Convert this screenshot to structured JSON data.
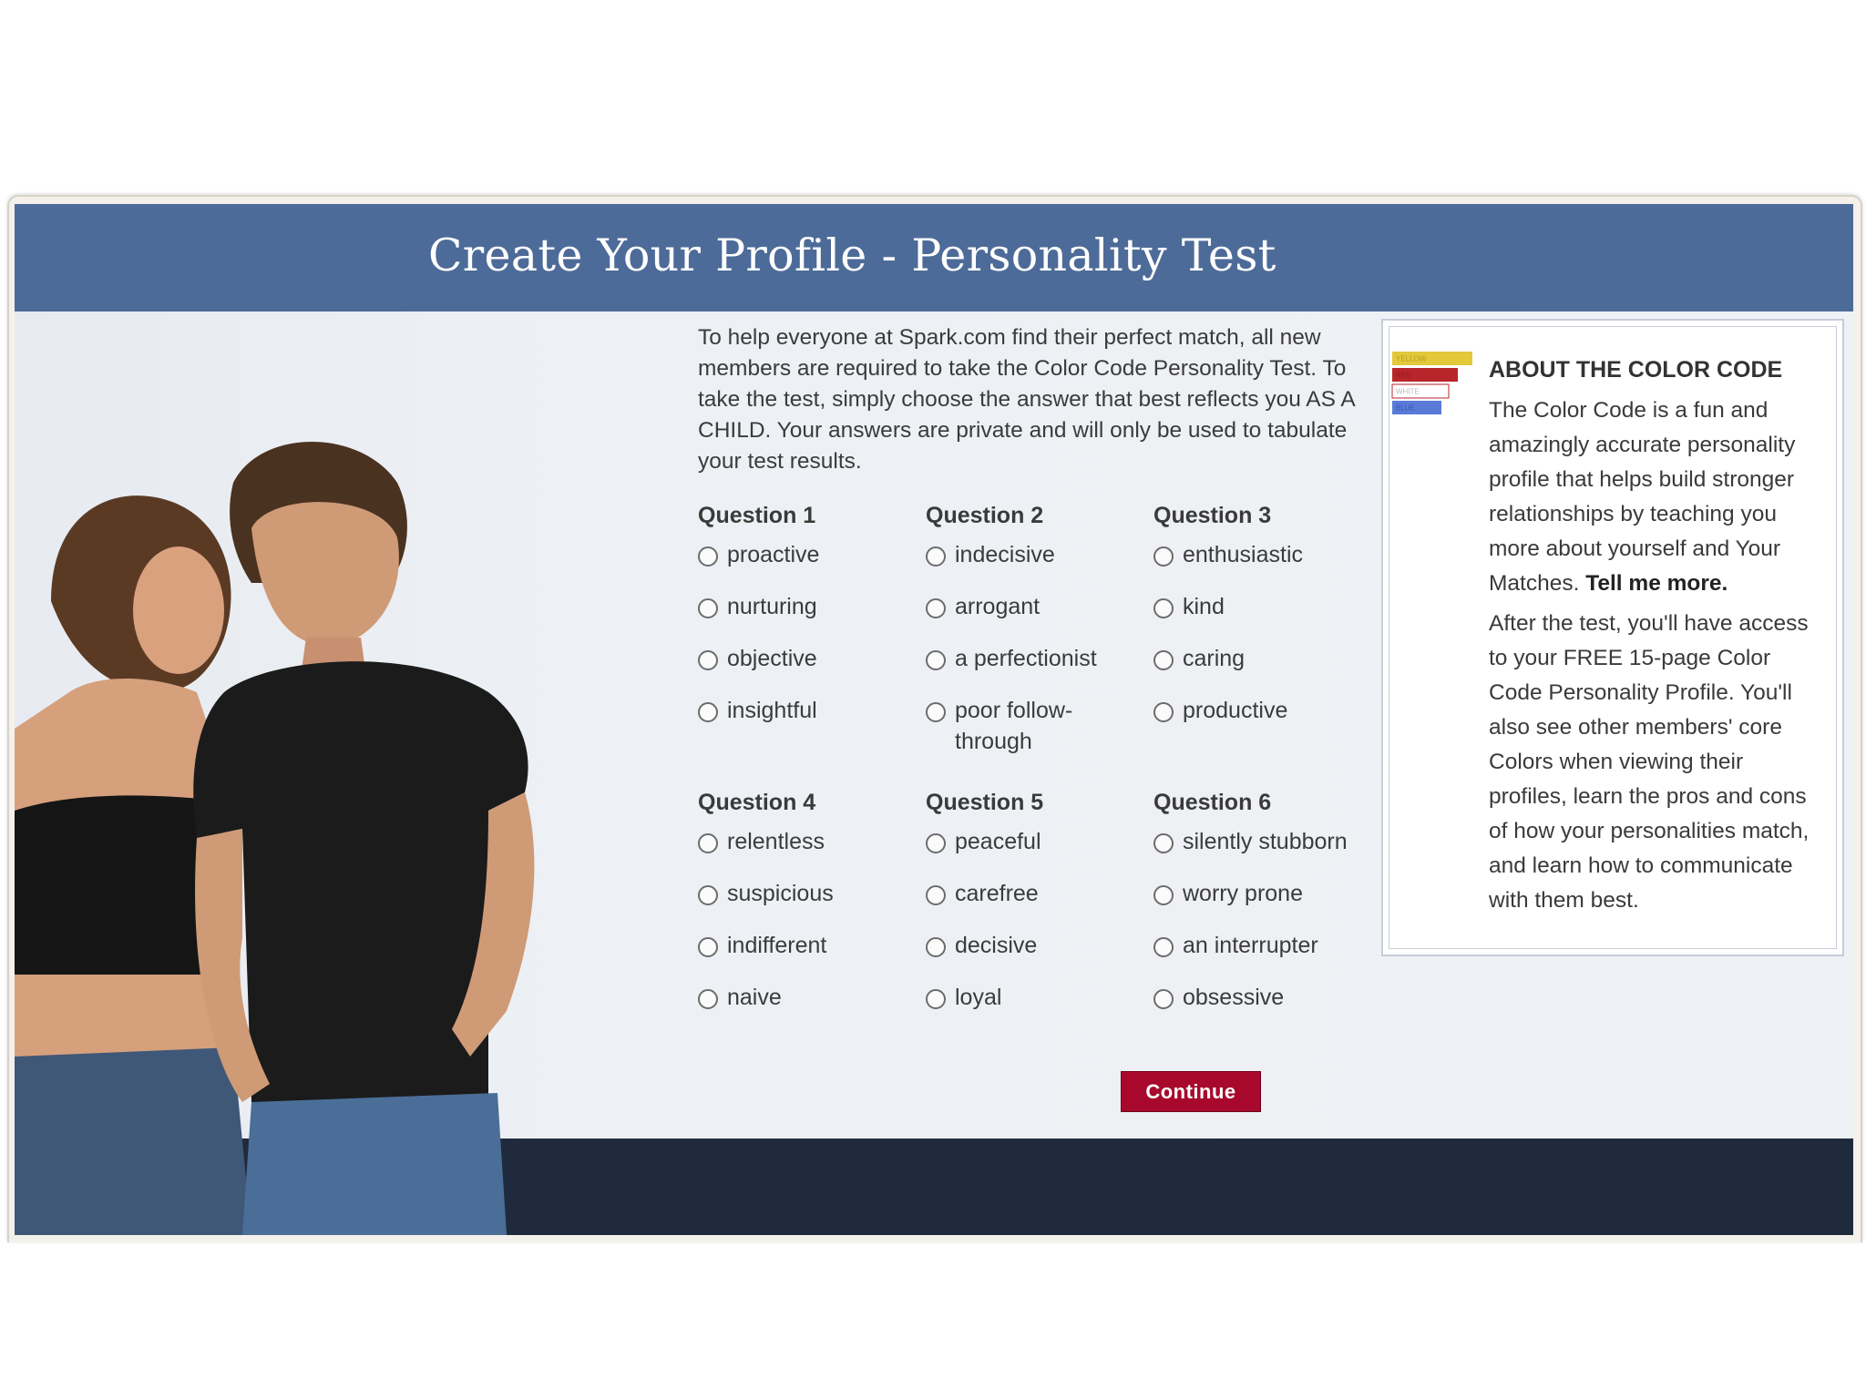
{
  "header": {
    "title": "Create Your Profile - Personality Test"
  },
  "intro": "To help everyone at Spark.com find their perfect match, all new members are required to take the Color Code Personality Test. To take the test, simply choose the answer that best reflects you AS A CHILD. Your answers are private and will only be used to tabulate your test results.",
  "questions": [
    {
      "label": "Question 1",
      "options": [
        "proactive",
        "nurturing",
        "objective",
        "insightful"
      ]
    },
    {
      "label": "Question 2",
      "options": [
        "indecisive",
        "arrogant",
        "a perfectionist",
        "poor follow-through"
      ]
    },
    {
      "label": "Question 3",
      "options": [
        "enthusiastic",
        "kind",
        "caring",
        "productive"
      ]
    },
    {
      "label": "Question 4",
      "options": [
        "relentless",
        "suspicious",
        "indifferent",
        "naive"
      ]
    },
    {
      "label": "Question 5",
      "options": [
        "peaceful",
        "carefree",
        "decisive",
        "loyal"
      ]
    },
    {
      "label": "Question 6",
      "options": [
        "silently stubborn",
        "worry prone",
        "an interrupter",
        "obsessive"
      ]
    }
  ],
  "continue_label": "Continue",
  "aside": {
    "title": "ABOUT THE COLOR CODE",
    "para1": "The Color Code is a fun and amazingly accurate personality profile that helps build stronger relationships by teaching you more about yourself and Your Matches.",
    "link": "Tell me more.",
    "para2": "After the test, you'll have access to your FREE 15-page Color Code Personality Profile. You'll also see other members' core Colors when viewing their profiles, learn the pros and cons of how your personalities match, and learn how to communicate with them best.",
    "logo_labels": [
      "YELLOW",
      "RED",
      "WHITE",
      "BLUE"
    ]
  },
  "colors": {
    "header": "#4d6b98",
    "button": "#a8082c",
    "footer": "#1f2b3d",
    "logo": [
      "#e3c83a",
      "#b8262c",
      "#ffffff",
      "#5a7ad8"
    ]
  }
}
